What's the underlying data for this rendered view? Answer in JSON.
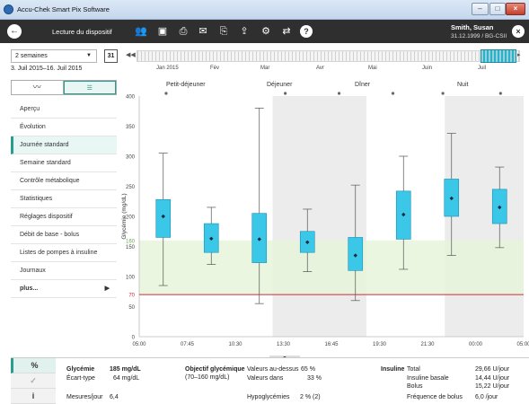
{
  "window": {
    "title": "Accu-Chek Smart Pix Software",
    "btn_min": "–",
    "btn_max": "□",
    "btn_close": "×"
  },
  "toolbar": {
    "view_title": "Lecture du dispositif",
    "icons": [
      "users-icon",
      "save-icon",
      "print-icon",
      "mail-icon",
      "pdf-icon",
      "export-icon",
      "settings-icon",
      "device-icon",
      "help-icon"
    ],
    "patient_name": "Smith, Susan",
    "patient_info": "31.12.1999 / BG-CSII"
  },
  "range": {
    "period": "2 semaines",
    "calendar_day": "31",
    "dates": "3. Juil 2015–16. Juil 2015",
    "months": [
      "Jan 2015",
      "Fév",
      "Mar",
      "Avr",
      "Mai",
      "Juin",
      "Juil"
    ]
  },
  "sidebar": {
    "toggle_graph": "〰",
    "toggle_table": "☰",
    "items": [
      "Aperçu",
      "Évolution",
      "Journée standard",
      "Semaine standard",
      "Contrôle métabolique",
      "Statistiques",
      "Réglages dispositif",
      "Débit de base - bolus",
      "Listes de pompes à insuline",
      "Journaux",
      "plus..."
    ],
    "active_index": 2
  },
  "chart_data": {
    "type": "boxplot",
    "ylabel": "Glycémie (mg/dL)",
    "ylim": [
      0,
      400
    ],
    "yticks": [
      0,
      50,
      70,
      100,
      150,
      160,
      200,
      250,
      300,
      350,
      400
    ],
    "xticks": [
      "05:00",
      "07:45",
      "10:30",
      "13:30",
      "16:45",
      "19:30",
      "21:30",
      "00:00",
      "05:00"
    ],
    "target_range": [
      70,
      160
    ],
    "hypo_line": 70,
    "periods": [
      "Petit-déjeuner",
      "Déjeuner",
      "Dîner",
      "Nuit"
    ],
    "boxes": [
      {
        "min": 85,
        "q1": 165,
        "median": 200,
        "q3": 228,
        "max": 305
      },
      {
        "min": 120,
        "q1": 140,
        "median": 163,
        "q3": 188,
        "max": 215
      },
      {
        "min": 55,
        "q1": 123,
        "median": 162,
        "q3": 205,
        "max": 380
      },
      {
        "min": 108,
        "q1": 140,
        "median": 157,
        "q3": 175,
        "max": 212
      },
      {
        "min": 60,
        "q1": 110,
        "median": 135,
        "q3": 165,
        "max": 252
      },
      {
        "min": 112,
        "q1": 162,
        "median": 203,
        "q3": 242,
        "max": 300
      },
      {
        "min": 135,
        "q1": 200,
        "median": 230,
        "q3": 262,
        "max": 338
      },
      {
        "min": 148,
        "q1": 188,
        "median": 215,
        "q3": 245,
        "max": 282
      }
    ]
  },
  "colors": {
    "box": "#3ac7e8",
    "target": "#e6f4d9",
    "hypo": "#cc2a3a",
    "shade": "#ececec",
    "accent": "#2a9d8f"
  },
  "stats": {
    "tab_percent": "%",
    "tab_check": "✓",
    "tab_info": "i",
    "glycemia_label": "Glycémie",
    "glycemia_value": "185 mg/dL",
    "sd_label": "Écart-type",
    "sd_value": "64 mg/dL",
    "measures_label": "Mesures/jour",
    "measures_value": "6,4",
    "target_label": "Objectif glycémique",
    "target_range": "(70–160 mg/dL)",
    "above_label": "Valeurs au-dessus",
    "above_value": "65 %",
    "within_label": "Valeurs dans",
    "within_value": "33 %",
    "hypo_label": "Hypoglycémies",
    "hypo_value": "2 % (2)",
    "insulin_label": "Insuline",
    "total_label": "Total",
    "total_value": "29,66 U/jour",
    "basal_label": "Insuline basale",
    "basal_value": "14,44 U/jour",
    "bolus_label": "Bolus",
    "bolus_value": "15,22 U/jour",
    "bolus_freq_label": "Fréquence de bolus",
    "bolus_freq_value": "6,0 /jour"
  }
}
